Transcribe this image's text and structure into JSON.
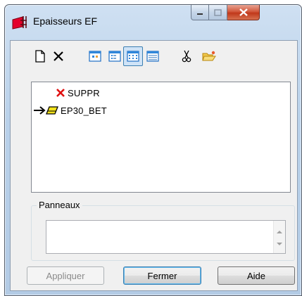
{
  "window": {
    "title": "Epaisseurs EF"
  },
  "toolbar": {
    "buttons": [
      {
        "name": "new",
        "icon": "new-document-icon"
      },
      {
        "name": "delete",
        "icon": "delete-x-icon"
      },
      {
        "name": "view-large",
        "icon": "view-large-icons-icon"
      },
      {
        "name": "view-small",
        "icon": "view-small-icons-icon"
      },
      {
        "name": "view-list",
        "icon": "view-list-icon",
        "pressed": true
      },
      {
        "name": "view-details",
        "icon": "view-details-icon"
      },
      {
        "name": "cut",
        "icon": "scissors-icon"
      },
      {
        "name": "open",
        "icon": "open-folder-icon"
      }
    ]
  },
  "tree": {
    "items": [
      {
        "label": "SUPPR",
        "icon": "red-x-icon",
        "current": false
      },
      {
        "label": "EP30_BET",
        "icon": "yellow-panel-icon",
        "current": true
      }
    ]
  },
  "panneaux": {
    "label": "Panneaux",
    "value": ""
  },
  "buttons": {
    "apply": "Appliquer",
    "close": "Fermer",
    "help": "Aide"
  }
}
